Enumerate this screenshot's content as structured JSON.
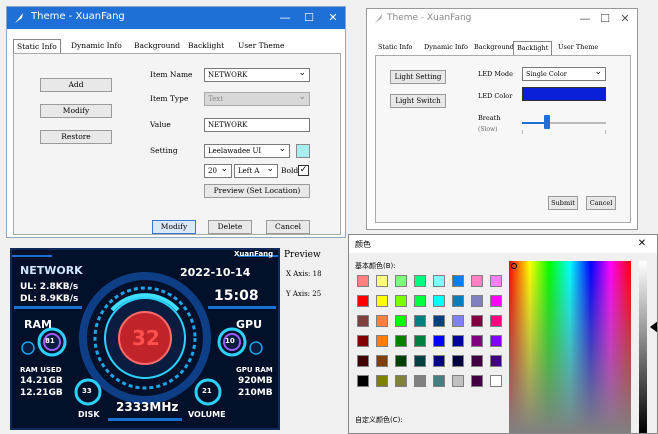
{
  "win1": {
    "title": "Theme - XuanFang",
    "tabs": [
      "Static Info",
      "Dynamic Info",
      "Background",
      "Backlight",
      "User Theme"
    ],
    "left_buttons": [
      "Add",
      "Modify",
      "Restore"
    ],
    "labels": {
      "item_name": "Item Name",
      "item_type": "Item Type",
      "value": "Value",
      "setting": "Setting"
    },
    "item_name": "NETWORK",
    "item_type": "Text",
    "value": "NETWORK",
    "font": "Leelawadee UI",
    "font_color": "#a8eef0",
    "size": "20",
    "align": "Left A",
    "bold_label": "Bold",
    "preview_btn": "Preview (Set Location)",
    "bottom_buttons": [
      "Modify",
      "Delete",
      "Cancel"
    ]
  },
  "win2": {
    "title": "Theme - XuanFang",
    "tabs": [
      "Static Info",
      "Dynamic Info",
      "Background",
      "Backlight",
      "User Theme"
    ],
    "buttons": [
      "Light Setting",
      "Light Switch"
    ],
    "led_mode_label": "LED Mode",
    "led_mode": "Single Color",
    "led_color_label": "LED Color",
    "led_color": "#0a1fd8",
    "breath_label": "Breath",
    "breath_sub": "(Slow)",
    "breath_value": 0.3,
    "submit": "Submit",
    "cancel": "Cancel"
  },
  "preview": {
    "title": "Preview",
    "x_axis": "X Axis: 18",
    "y_axis": "Y Axis: 25"
  },
  "dash": {
    "brand": "XuanFang",
    "network": "NETWORK",
    "ul": "UL: 2.8KB/s",
    "dl": "DL: 8.9KB/s",
    "date": "2022-10-14",
    "time": "15:08",
    "ram": "RAM",
    "ram_pct": "81",
    "gpu": "GPU",
    "gpu_pct": "10",
    "cpu_temp": "32",
    "ram_used_label": "RAM USED",
    "ram_used_1": "14.21GB",
    "ram_used_2": "12.21GB",
    "disk_pct": "33",
    "disk": "DISK",
    "freq": "2333MHz",
    "volume_pct": "21",
    "volume": "VOLUME",
    "gpu_ram_label": "GPU RAM",
    "gpu_ram_1": "920MB",
    "gpu_ram_2": "210MB"
  },
  "color_dialog": {
    "title": "颜色",
    "basic_colors_label": "基本颜色(B):",
    "custom_colors_label": "自定义颜色(C):",
    "basic_colors": [
      "#ff8080",
      "#ffff80",
      "#80ff80",
      "#00ff80",
      "#80ffff",
      "#0080ff",
      "#ff80c0",
      "#ff80ff",
      "#ff0000",
      "#ffff00",
      "#80ff00",
      "#00ff40",
      "#00ffff",
      "#0080c0",
      "#8080c0",
      "#ff00ff",
      "#804040",
      "#ff8040",
      "#00ff00",
      "#008080",
      "#004080",
      "#8080ff",
      "#800040",
      "#ff0080",
      "#800000",
      "#ff8000",
      "#008000",
      "#008040",
      "#0000ff",
      "#0000a0",
      "#800080",
      "#8000ff",
      "#400000",
      "#804000",
      "#004000",
      "#004040",
      "#000080",
      "#000040",
      "#400040",
      "#400080",
      "#000000",
      "#808000",
      "#808040",
      "#808080",
      "#408080",
      "#c0c0c0",
      "#400040",
      "#ffffff"
    ]
  }
}
